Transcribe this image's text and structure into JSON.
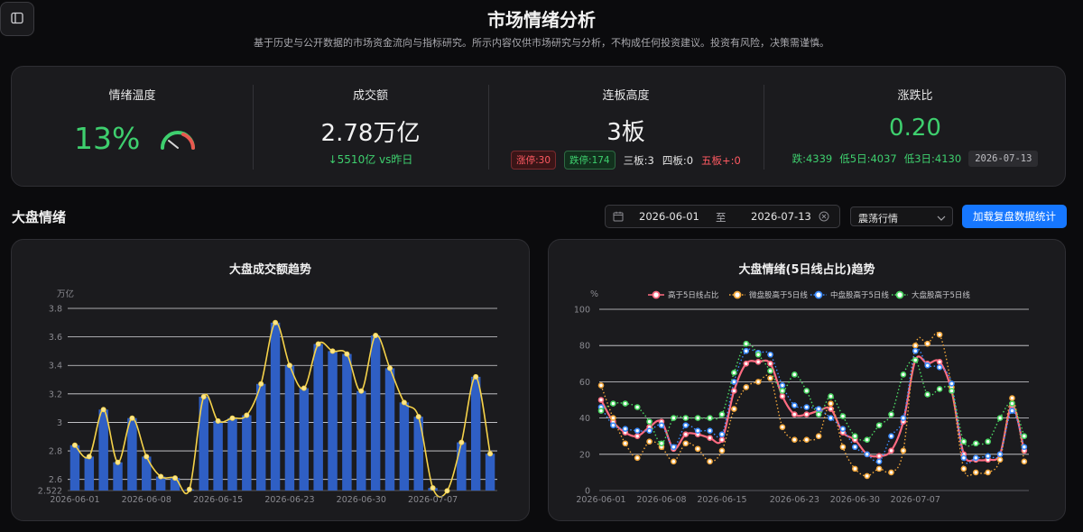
{
  "page": {
    "title": "市场情绪分析",
    "subtitle": "基于历史与公开数据的市场资金流向与指标研究。所示内容仅供市场研究与分析，不构成任何投资建议。投资有风险，决策需谨慎。"
  },
  "stats": {
    "sentiment": {
      "label": "情绪温度",
      "value": "13%",
      "gauge_level": 0.13
    },
    "turnover": {
      "label": "成交额",
      "value": "2.78万亿",
      "change": "↓5510亿 vs昨日"
    },
    "streak": {
      "label": "连板高度",
      "value": "3板",
      "limit_up": "涨停:30",
      "limit_down": "跌停:174",
      "board3": "三板:3",
      "board4": "四板:0",
      "board5": "五板+:0"
    },
    "ratio": {
      "label": "涨跌比",
      "value": "0.20",
      "fall": "跌:4339",
      "below5": "低5日:4037",
      "below3": "低3日:4130",
      "date": "2026-07-13"
    }
  },
  "section": {
    "title": "大盘情绪",
    "date_start": "2026-06-01",
    "date_sep": "至",
    "date_end": "2026-07-13",
    "select_value": "震荡行情",
    "load_button": "加载复盘数据统计"
  },
  "colors": {
    "bar": "#2f5fc4",
    "line_yellow": "#f5d24a",
    "pink": "#ff6b81",
    "orange": "#f3a73b",
    "blue": "#3b8bff",
    "green": "#4cd964",
    "accent": "#1677ff"
  },
  "icons": {
    "sidebar_toggle": "sidebar-icon",
    "calendar": "calendar-icon",
    "clear": "clear-icon",
    "chevron": "chevron-down-icon",
    "gauge": "gauge-icon"
  },
  "chart_data": [
    {
      "type": "bar",
      "title": "大盘成交额趋势",
      "unit": "万亿",
      "ylim": [
        2.522,
        3.8
      ],
      "y_ticks": [
        "2.522",
        "2.6",
        "2.8",
        "3",
        "3.2",
        "3.4",
        "3.6",
        "3.8"
      ],
      "x_labels": [
        "2026-06-01",
        "2026-06-08",
        "2026-06-15",
        "2026-06-23",
        "2026-06-30",
        "2026-07-07"
      ],
      "categories": [
        "2026-06-01",
        "2026-06-02",
        "2026-06-03",
        "2026-06-04",
        "2026-06-05",
        "2026-06-08",
        "2026-06-09",
        "2026-06-10",
        "2026-06-11",
        "2026-06-12",
        "2026-06-15",
        "2026-06-16",
        "2026-06-17",
        "2026-06-18",
        "2026-06-19",
        "2026-06-22",
        "2026-06-23",
        "2026-06-24",
        "2026-06-25",
        "2026-06-26",
        "2026-06-29",
        "2026-06-30",
        "2026-07-01",
        "2026-07-02",
        "2026-07-03",
        "2026-07-06",
        "2026-07-07",
        "2026-07-08",
        "2026-07-09",
        "2026-07-10",
        "2026-07-13"
      ],
      "values": [
        2.84,
        2.76,
        3.09,
        2.72,
        3.03,
        2.76,
        2.62,
        2.61,
        2.53,
        3.18,
        3.01,
        3.03,
        3.05,
        3.27,
        3.7,
        3.4,
        3.24,
        3.55,
        3.5,
        3.48,
        3.22,
        3.61,
        3.38,
        3.14,
        3.04,
        2.54,
        2.52,
        2.86,
        3.32,
        2.78
      ],
      "grid": true
    },
    {
      "type": "line",
      "title": "大盘情绪(5日线占比)趋势",
      "unit": "%",
      "ylim": [
        0,
        100
      ],
      "y_ticks": [
        "0",
        "20",
        "40",
        "60",
        "80",
        "100"
      ],
      "x_labels": [
        "2026-06-01",
        "2026-06-08",
        "2026-06-15",
        "2026-06-23",
        "2026-06-30",
        "2026-07-07"
      ],
      "legend_position": "top",
      "series": [
        {
          "name": "高于5日线占比",
          "color": "#ff6b81",
          "style": "solid",
          "values": [
            50,
            38,
            32,
            30,
            35,
            38,
            23,
            31,
            31,
            29,
            28,
            55,
            70,
            71,
            70,
            52,
            42,
            42,
            44,
            45,
            32,
            28,
            20,
            19,
            22,
            38,
            72,
            70,
            71,
            55,
            20,
            17,
            17,
            20,
            47,
            22
          ]
        },
        {
          "name": "微盘股高于5日线",
          "color": "#f3a73b",
          "style": "dotted",
          "values": [
            58,
            40,
            26,
            18,
            27,
            24,
            16,
            26,
            23,
            16,
            22,
            45,
            57,
            60,
            62,
            35,
            28,
            28,
            30,
            48,
            24,
            12,
            8,
            12,
            10,
            22,
            80,
            81,
            86,
            57,
            12,
            10,
            10,
            17,
            51,
            16
          ]
        },
        {
          "name": "中盘股高于5日线",
          "color": "#3b8bff",
          "style": "dotted",
          "values": [
            46,
            36,
            34,
            33,
            33,
            36,
            24,
            36,
            33,
            33,
            31,
            60,
            77,
            76,
            75,
            58,
            47,
            46,
            45,
            40,
            34,
            24,
            20,
            16,
            30,
            40,
            77,
            69,
            68,
            59,
            18,
            18,
            19,
            20,
            44,
            24
          ]
        },
        {
          "name": "大盘股高于5日线",
          "color": "#4cd964",
          "style": "dotted",
          "values": [
            44,
            48,
            48,
            46,
            38,
            26,
            40,
            40,
            40,
            40,
            42,
            65,
            81,
            75,
            66,
            55,
            64,
            55,
            42,
            52,
            41,
            30,
            28,
            36,
            42,
            64,
            72,
            53,
            56,
            55,
            27,
            26,
            27,
            40,
            48,
            30
          ]
        }
      ],
      "grid": true
    }
  ]
}
